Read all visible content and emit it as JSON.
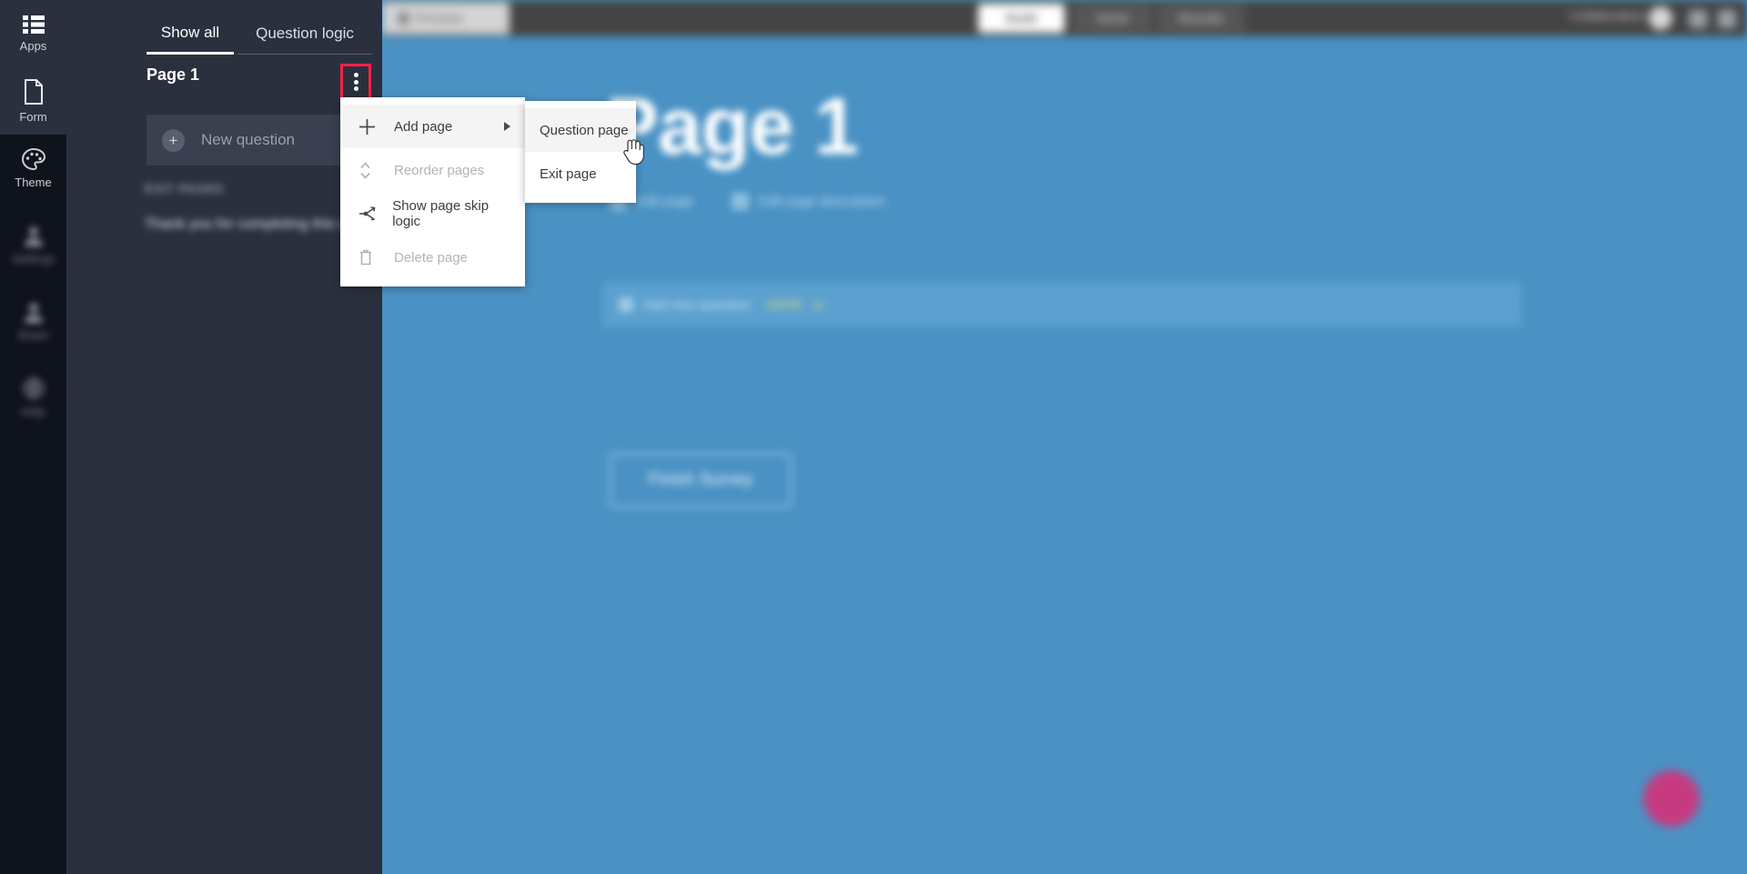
{
  "rail": {
    "items": [
      {
        "label": "Apps",
        "icon": "apps-list-icon",
        "active": false,
        "blurred": false
      },
      {
        "label": "Form",
        "icon": "document-icon",
        "active": true,
        "blurred": false
      },
      {
        "label": "Theme",
        "icon": "palette-icon",
        "active": false,
        "blurred": false
      },
      {
        "label": "Settings",
        "icon": "person-icon",
        "active": false,
        "blurred": true
      },
      {
        "label": "Share",
        "icon": "person-icon",
        "active": false,
        "blurred": true
      },
      {
        "label": "Help",
        "icon": "globe-icon",
        "active": false,
        "blurred": true
      }
    ]
  },
  "panel": {
    "tabs": [
      {
        "label": "Show all",
        "active": true
      },
      {
        "label": "Question logic",
        "active": false
      }
    ],
    "page_label": "Page 1",
    "kebab_icon": "more-vertical-icon",
    "new_question": {
      "label": "New question",
      "icon": "plus-circle-icon"
    },
    "exit_section": {
      "header": "EXIT PAGES",
      "item": "Thank you for completing this survey"
    }
  },
  "context_menu": {
    "items": [
      {
        "label": "Add page",
        "icon": "plus-icon",
        "disabled": false,
        "hover": true,
        "submenu": true
      },
      {
        "label": "Reorder pages",
        "icon": "sort-icon",
        "disabled": true,
        "hover": false,
        "submenu": false
      },
      {
        "label": "Show page skip logic",
        "icon": "skip-logic-icon",
        "disabled": false,
        "hover": false,
        "submenu": false
      },
      {
        "label": "Delete page",
        "icon": "trash-icon",
        "disabled": true,
        "hover": false,
        "submenu": false
      }
    ]
  },
  "submenu": {
    "items": [
      {
        "label": "Question page",
        "hover": true
      },
      {
        "label": "Exit page",
        "hover": false
      }
    ]
  },
  "canvas": {
    "topbar": {
      "preview_label": "Preview",
      "preview_icon": "lock-icon",
      "segments": [
        {
          "label": "Build",
          "active": true
        },
        {
          "label": "Send",
          "active": false
        },
        {
          "label": "Results",
          "active": false
        }
      ],
      "collaborators_label": "Collaborators",
      "avatar_icon": "user-avatar",
      "icons": [
        "notification-icon",
        "menu-icon"
      ]
    },
    "page_title": "Page 1",
    "meta": [
      {
        "label": "Edit page",
        "icon": "edit-icon"
      },
      {
        "label": "Edit page description",
        "icon": "description-icon"
      }
    ],
    "add_question_bar": {
      "icon": "plus-icon",
      "text": "Add new question",
      "accent": "HERE",
      "accent2": "or",
      "accent_color": "#d7d97e"
    },
    "finish_button": "Finish Survey",
    "fab": {
      "icon": "help-fab-icon",
      "color": "#c83a80"
    }
  },
  "colors": {
    "rail_bg": "#0f131c",
    "panel_bg": "#2b303e",
    "canvas_blue": "#4a92c4",
    "highlight_red": "#f0224a",
    "accent_white": "#ffffff"
  }
}
